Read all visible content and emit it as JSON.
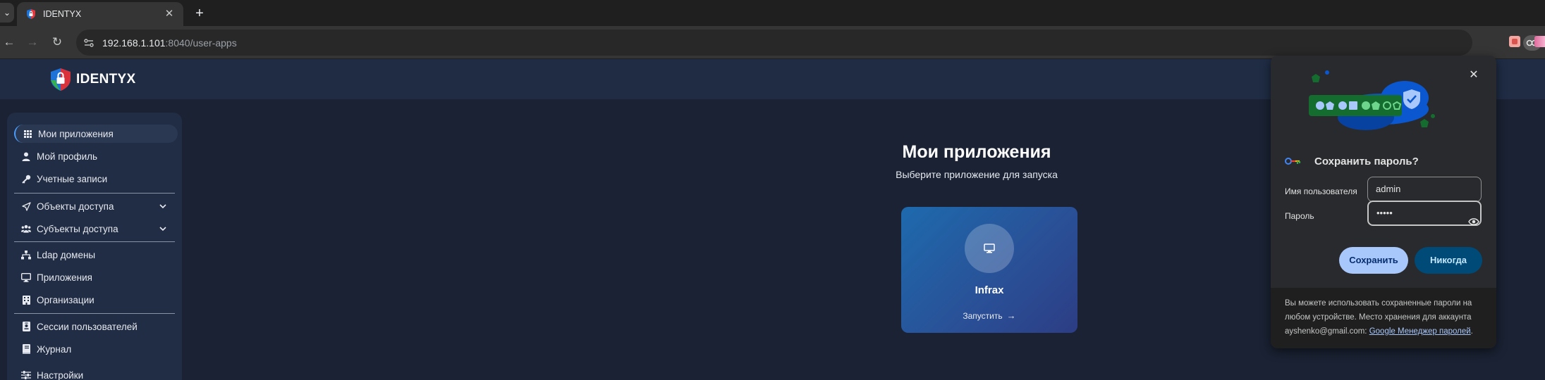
{
  "browser": {
    "tab_title": "IDENTYX",
    "tab_list_glyph": "⌄",
    "close_glyph": "✕",
    "new_tab_glyph": "+",
    "back_glyph": "←",
    "forward_glyph": "→",
    "reload_glyph": "↻",
    "star_glyph": "☆",
    "url_host": "192.168.1.101",
    "url_rest": ":8040/user-apps"
  },
  "header": {
    "brand": "IDENTYX"
  },
  "sidebar": {
    "items": [
      {
        "label": "Мои приложения",
        "icon": "grid-icon"
      },
      {
        "label": "Мой профиль",
        "icon": "user-icon"
      },
      {
        "label": "Учетные записи",
        "icon": "key-icon"
      },
      {
        "label": "Объекты доступа",
        "icon": "send-icon"
      },
      {
        "label": "Субъекты доступа",
        "icon": "users-icon"
      },
      {
        "label": "Ldap домены",
        "icon": "sitemap-icon"
      },
      {
        "label": "Приложения",
        "icon": "monitor-icon"
      },
      {
        "label": "Организации",
        "icon": "building-icon"
      },
      {
        "label": "Сессии пользователей",
        "icon": "id-badge-icon"
      },
      {
        "label": "Журнал",
        "icon": "book-icon"
      },
      {
        "label": "Настройки",
        "icon": "sliders-icon"
      }
    ]
  },
  "main": {
    "title": "Мои приложения",
    "subtitle": "Выберите приложение для запуска",
    "apps": [
      {
        "name": "Infrax",
        "launch_label": "Запустить",
        "icon": "monitor-icon"
      }
    ],
    "launch_arrow": "→"
  },
  "password_popup": {
    "close_glyph": "✕",
    "heading": "Сохранить пароль?",
    "username_label": "Имя пользователя",
    "username_value": "admin",
    "password_label": "Пароль",
    "password_value": "•••••",
    "save_label": "Сохранить",
    "never_label": "Никогда",
    "footer_text": "Вы можете использовать сохраненные пароли на любом устройстве. Место хранения для аккаунта ayshenko@gmail.com: ",
    "footer_link": "Google Менеджер паролей",
    "footer_end": "."
  },
  "colors": {
    "page_bg": "#1a2233",
    "header_bg": "#1f2c44",
    "sidebar_bg": "#212d44",
    "accent": "#4a9eff",
    "card_gradient_start": "#1e6aad",
    "card_gradient_end": "#2c3d84",
    "popup_bg": "#282a2d",
    "save_button": "#a8c7fa",
    "never_button": "#004a77"
  }
}
